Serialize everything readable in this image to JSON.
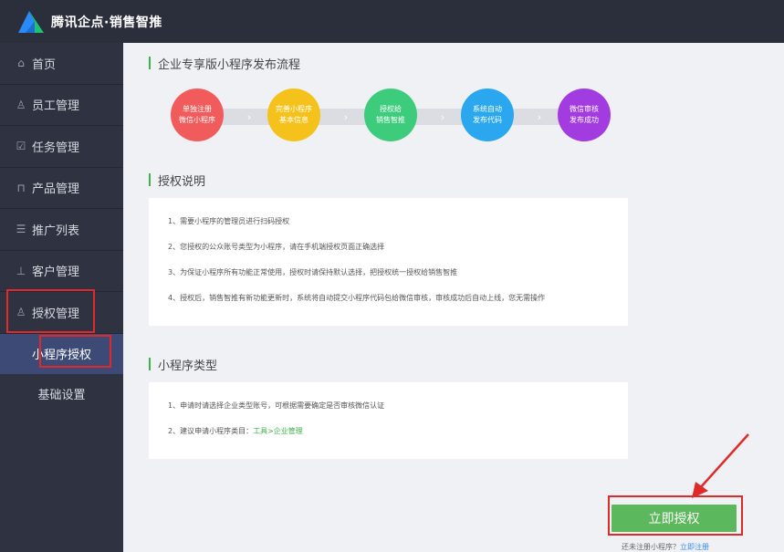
{
  "header": {
    "brand": "腾讯企点·销售智推"
  },
  "sidebar": {
    "items": [
      {
        "icon": "home-icon",
        "glyph": "⌂",
        "label": "首页"
      },
      {
        "icon": "user-icon",
        "glyph": "♙",
        "label": "员工管理"
      },
      {
        "icon": "task-icon",
        "glyph": "☑",
        "label": "任务管理"
      },
      {
        "icon": "product-icon",
        "glyph": "⊓",
        "label": "产品管理"
      },
      {
        "icon": "list-icon",
        "glyph": "☰",
        "label": "推广列表"
      },
      {
        "icon": "customer-icon",
        "glyph": "⊥",
        "label": "客户管理"
      },
      {
        "icon": "auth-icon",
        "glyph": "♙",
        "label": "授权管理"
      }
    ],
    "sub_items": [
      {
        "label": "小程序授权"
      },
      {
        "label": "基础设置"
      }
    ]
  },
  "main": {
    "flow_title": "企业专享版小程序发布流程",
    "steps": [
      {
        "line1": "单独注册",
        "line2": "微信小程序",
        "color": "#f25b5b"
      },
      {
        "line1": "完善小程序",
        "line2": "基本信息",
        "color": "#f5c21b"
      },
      {
        "line1": "授权给",
        "line2": "销售智推",
        "color": "#3ccc7c"
      },
      {
        "line1": "系统自动",
        "line2": "发布代码",
        "color": "#2aa7ee"
      },
      {
        "line1": "微信审核",
        "line2": "发布成功",
        "color": "#a23be0"
      }
    ],
    "auth_title": "授权说明",
    "auth_notes": [
      "1、需要小程序的管理员进行扫码授权",
      "2、您授权的公众账号类型为小程序，请在手机端授权页面正确选择",
      "3、为保证小程序所有功能正常使用，授权时请保持默认选择，把授权统一授权给销售智推",
      "4、授权后，销售智推有新功能更新时，系统将自动提交小程序代码包给微信审核，审核成功后自动上线，您无需操作"
    ],
    "type_title": "小程序类型",
    "type_notes": {
      "line1": "1、申请时请选择企业类型账号，可根据需要确定是否审核微信认证",
      "line2_prefix": "2、建议申请小程序类目：",
      "line2_link": "工具>企业管理"
    },
    "auth_button": "立即授权",
    "register_prefix": "还未注册小程序？",
    "register_link": "立即注册"
  },
  "colors": {
    "accent_green": "#3cb34a",
    "button_green": "#5cb85c",
    "highlight_red": "#e02a2a",
    "sidebar_bg": "#2f3240",
    "header_bg": "#2b2e3b"
  }
}
